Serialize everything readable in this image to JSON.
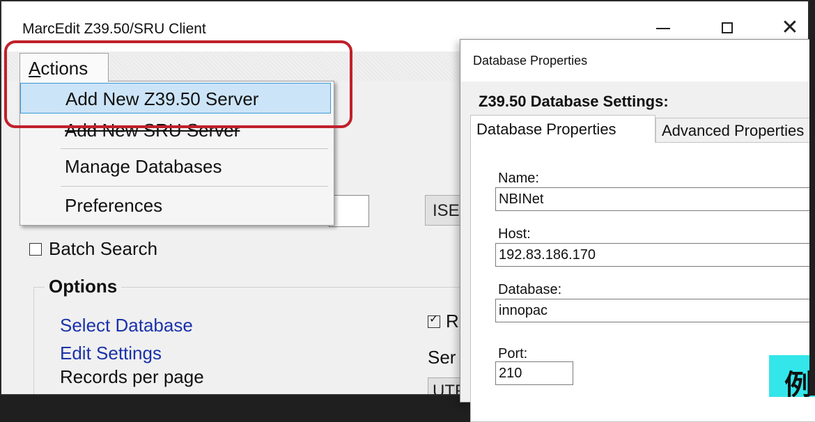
{
  "window": {
    "title": "MarcEdit Z39.50/SRU Client",
    "controls": {
      "minimize": "—",
      "maximize": "☐",
      "close": "✕"
    }
  },
  "menu": {
    "actions_label": "Actions",
    "items": [
      {
        "label": "Add New Z39.50 Server",
        "selected": true
      },
      {
        "label": "Add New SRU Server",
        "selected": false
      },
      {
        "label": "Manage Databases",
        "selected": false
      },
      {
        "label": "Preferences",
        "selected": false
      }
    ]
  },
  "main": {
    "isbn_button": "ISE",
    "batch_search": "Batch Search",
    "options_title": "Options",
    "select_database": "Select Database",
    "edit_settings": "Edit Settings",
    "records_per_page": "Records per page",
    "r_checkbox": "R",
    "ser_label": "Ser",
    "utf_value": "UTF"
  },
  "dialog": {
    "title": "Database Properties",
    "heading": "Z39.50 Database Settings:",
    "tabs": [
      "Database Properties",
      "Advanced Properties"
    ],
    "fields": {
      "name_label": "Name:",
      "name_value": "NBINet",
      "host_label": "Host:",
      "host_value": "192.83.186.170",
      "database_label": "Database:",
      "database_value": "innopac",
      "port_label": "Port:",
      "port_value": "210"
    }
  },
  "overlay": {
    "highlight_color": "#c0202a",
    "cyan_badge_text": "例"
  }
}
